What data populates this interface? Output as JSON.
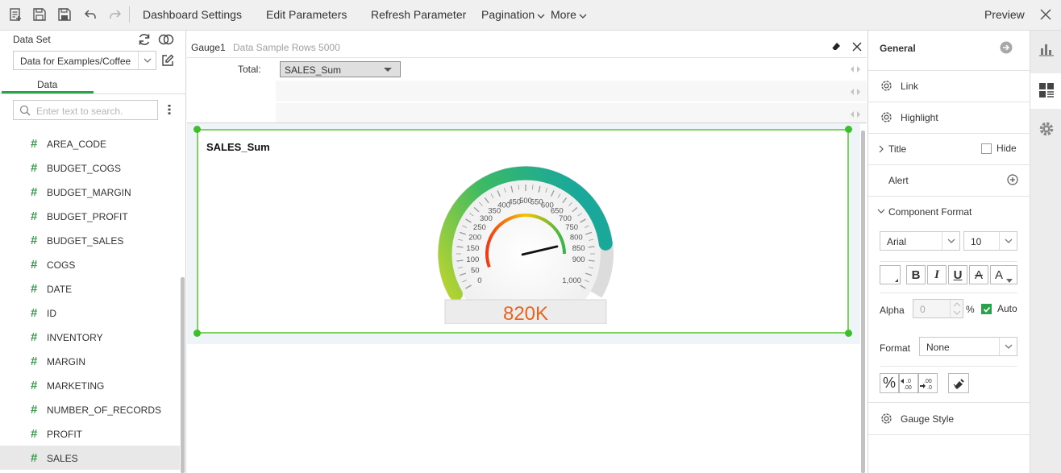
{
  "toolbar": {
    "dashboard_settings": "Dashboard Settings",
    "edit_parameters": "Edit Parameters",
    "refresh_parameter": "Refresh Parameter",
    "pagination": "Pagination",
    "more": "More",
    "preview": "Preview"
  },
  "left": {
    "dataset_label": "Data Set",
    "dataset_value": "Data for Examples/Coffee",
    "tab_data": "Data",
    "search_placeholder": "Enter text to search.",
    "fields": [
      "AREA_CODE",
      "BUDGET_COGS",
      "BUDGET_MARGIN",
      "BUDGET_PROFIT",
      "BUDGET_SALES",
      "COGS",
      "DATE",
      "ID",
      "INVENTORY",
      "MARGIN",
      "MARKETING",
      "NUMBER_OF_RECORDS",
      "PROFIT",
      "SALES"
    ],
    "selected_field": "SALES"
  },
  "center": {
    "component_name": "Gauge1",
    "subtitle": "Data Sample Rows 5000",
    "total_label": "Total:",
    "total_value": "SALES_Sum",
    "gauge": {
      "title": "SALES_Sum",
      "value": 820000,
      "display_value": "820K",
      "min": 0,
      "max": 1000,
      "ticks": [
        "0",
        "50",
        "100",
        "150",
        "200",
        "250",
        "300",
        "350",
        "400",
        "450",
        "500",
        "550",
        "600",
        "650",
        "700",
        "750",
        "800",
        "850",
        "900",
        "1,000"
      ],
      "needle_value": 820,
      "colors": {
        "arc_start": "#b9d430",
        "arc_mid": "#3dba63",
        "arc_end": "#1aa89a",
        "inner_low": "#ef3b16",
        "inner_mid": "#f5c400",
        "inner_high": "#37b44a",
        "value_text": "#e8641e"
      }
    }
  },
  "right": {
    "general": "General",
    "link": "Link",
    "highlight": "Highlight",
    "title": "Title",
    "hide": "Hide",
    "alert": "Alert",
    "component_format": "Component Format",
    "font_family": "Arial",
    "font_size": "10",
    "alpha_label": "Alpha",
    "alpha_value": "0",
    "alpha_unit": "%",
    "auto_label": "Auto",
    "format_label": "Format",
    "format_value": "None",
    "gauge_style": "Gauge Style",
    "bold": "B",
    "italic": "I",
    "underline": "U",
    "strike": "A",
    "font_color": "A",
    "percent": "%"
  },
  "accent_color": "#29a34b"
}
